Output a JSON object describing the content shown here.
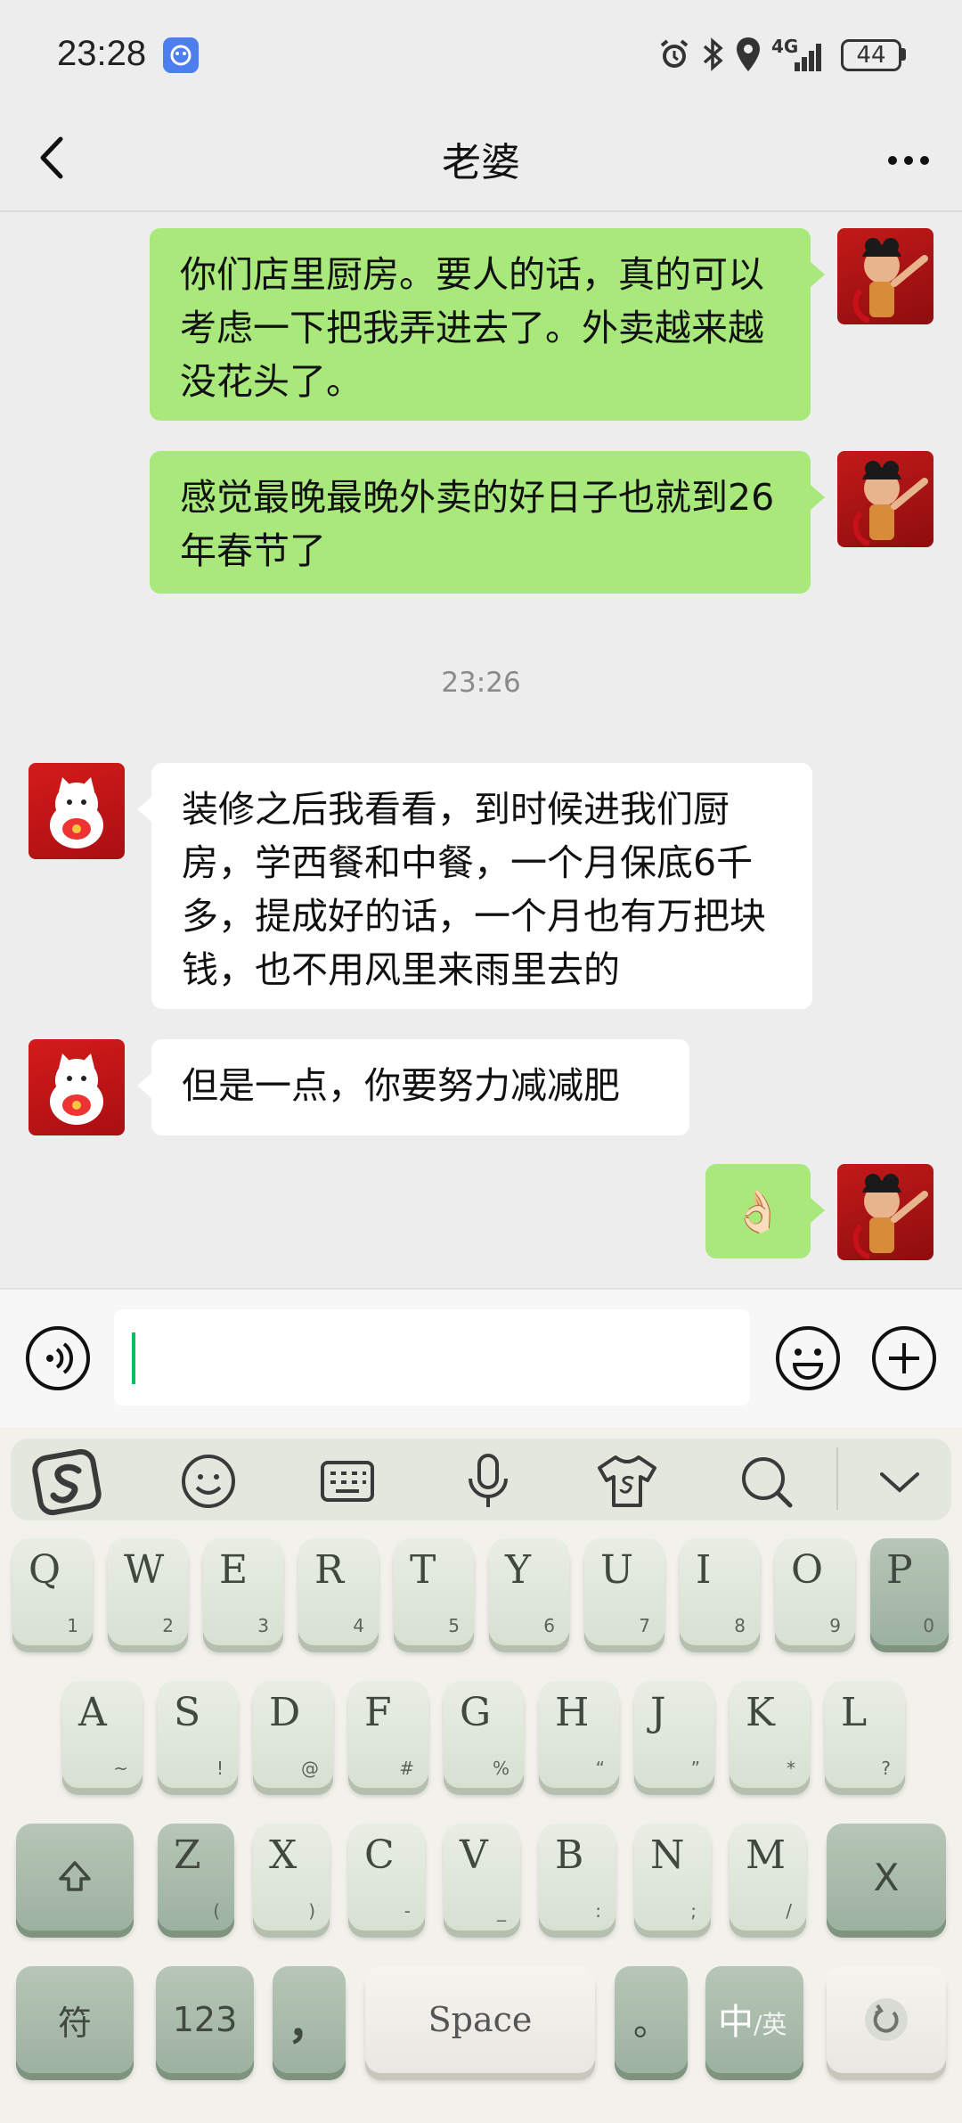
{
  "status": {
    "time": "23:28",
    "network": "4G",
    "battery": "44"
  },
  "header": {
    "title": "老婆"
  },
  "messages": [
    {
      "from": "me",
      "text": "你们店里厨房。要人的话，真的可以考虑一下把我弄进去了。外卖越来越没花头了。"
    },
    {
      "from": "me",
      "text": "感觉最晚最晚外卖的好日子也就到26年春节了"
    },
    {
      "from": "other",
      "text": "装修之后我看看，到时候进我们厨房，学西餐和中餐，一个月保底6千多，提成好的话，一个月也有万把块钱，也不用风里来雨里去的"
    },
    {
      "from": "other",
      "text": "但是一点，你要努力减减肥"
    },
    {
      "from": "me",
      "text": "👌🏻"
    }
  ],
  "timestamp": "23:26",
  "input": {
    "value": ""
  },
  "keyboard": {
    "row1": [
      {
        "k": "Q",
        "s": "1"
      },
      {
        "k": "W",
        "s": "2"
      },
      {
        "k": "E",
        "s": "3"
      },
      {
        "k": "R",
        "s": "4"
      },
      {
        "k": "T",
        "s": "5"
      },
      {
        "k": "Y",
        "s": "6"
      },
      {
        "k": "U",
        "s": "7"
      },
      {
        "k": "I",
        "s": "8"
      },
      {
        "k": "O",
        "s": "9"
      },
      {
        "k": "P",
        "s": "0"
      }
    ],
    "row2": [
      {
        "k": "A",
        "s": "~"
      },
      {
        "k": "S",
        "s": "!"
      },
      {
        "k": "D",
        "s": "@"
      },
      {
        "k": "F",
        "s": "#"
      },
      {
        "k": "G",
        "s": "%"
      },
      {
        "k": "H",
        "s": "“"
      },
      {
        "k": "J",
        "s": "”"
      },
      {
        "k": "K",
        "s": "*"
      },
      {
        "k": "L",
        "s": "?"
      }
    ],
    "row3": [
      {
        "k": "Z",
        "s": "("
      },
      {
        "k": "X",
        "s": ")"
      },
      {
        "k": "C",
        "s": "-"
      },
      {
        "k": "V",
        "s": "_"
      },
      {
        "k": "B",
        "s": ":"
      },
      {
        "k": "N",
        "s": ";"
      },
      {
        "k": "M",
        "s": "/"
      }
    ],
    "symbol_label": "符",
    "numbers_label": "123",
    "comma_label": "，",
    "space_label": "Space",
    "period_label": "。",
    "lang_main": "中",
    "lang_sub": "/英",
    "delete_label": "X"
  },
  "colors": {
    "my_bubble": "#a9e97c",
    "other_bubble": "#ffffff",
    "background": "#ededed",
    "cursor": "#07c160"
  }
}
